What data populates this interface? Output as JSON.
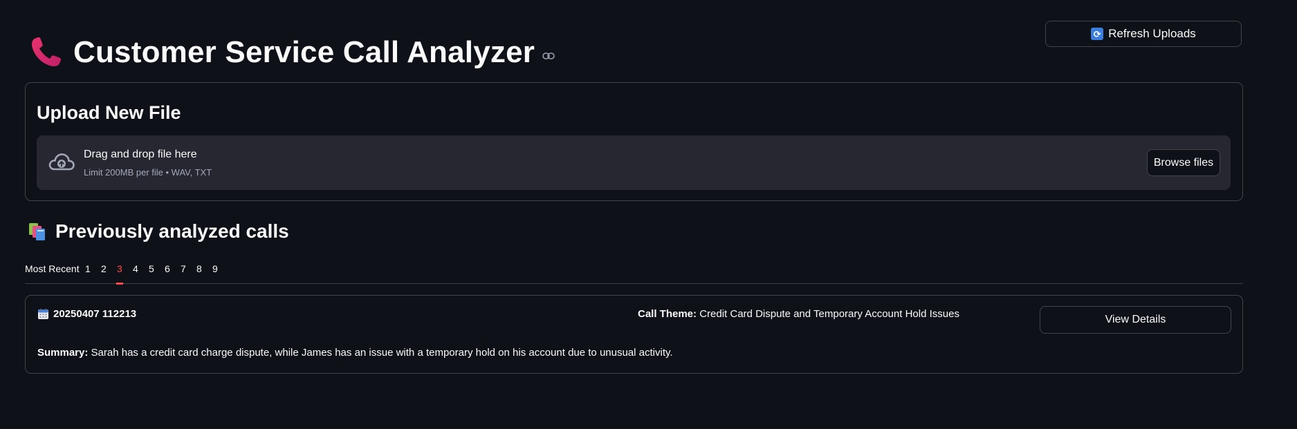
{
  "header": {
    "title": "Customer Service Call Analyzer",
    "refresh_label": "Refresh Uploads"
  },
  "upload": {
    "title": "Upload New File",
    "drop_text": "Drag and drop file here",
    "limit_text": "Limit 200MB per file • WAV, TXT",
    "browse_label": "Browse files"
  },
  "history": {
    "title": "Previously analyzed calls",
    "tabs": [
      {
        "label": "Most Recent"
      },
      {
        "label": "1"
      },
      {
        "label": "2"
      },
      {
        "label": "3"
      },
      {
        "label": "4"
      },
      {
        "label": "5"
      },
      {
        "label": "6"
      },
      {
        "label": "7"
      },
      {
        "label": "8"
      },
      {
        "label": "9"
      }
    ],
    "active_tab": "3"
  },
  "call": {
    "id": "20250407 112213",
    "theme_label": "Call Theme:",
    "theme": "Credit Card Dispute and Temporary Account Hold Issues",
    "summary_label": "Summary:",
    "summary": "Sarah has a credit card charge dispute, while James has an issue with a temporary hold on his account due to unusual activity.",
    "view_label": "View Details"
  },
  "colors": {
    "background": "#0e1117",
    "active_tab": "#ff4b4b",
    "dropzone": "#262730"
  }
}
